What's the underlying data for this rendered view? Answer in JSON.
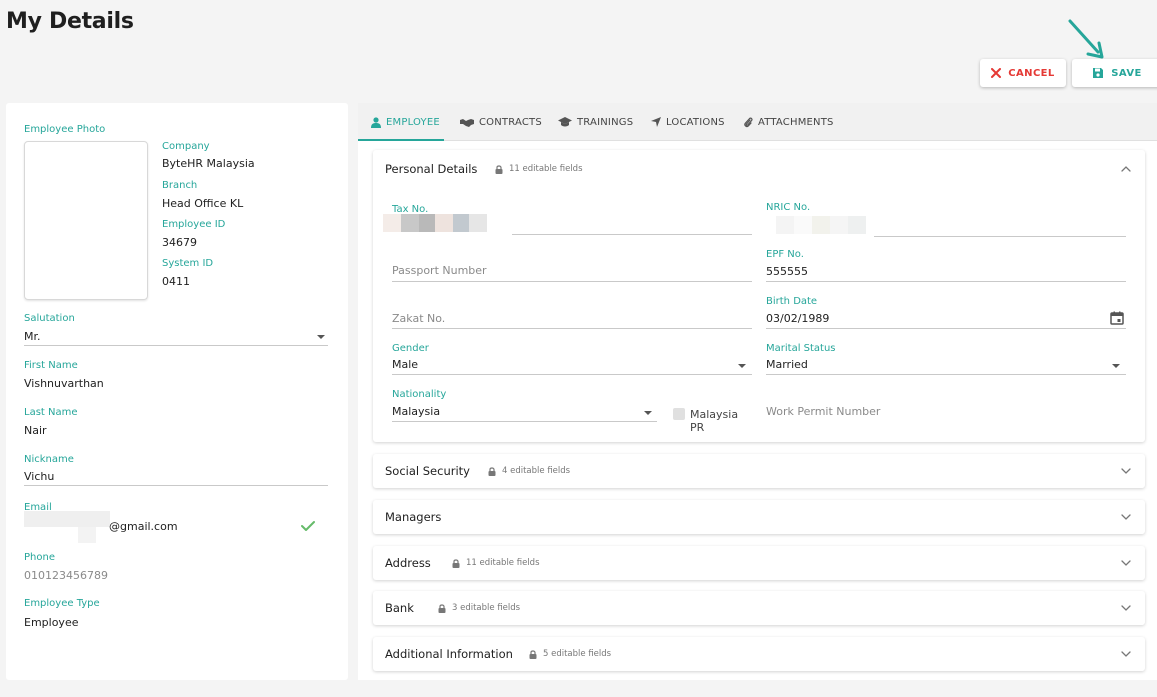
{
  "page": {
    "title": "My Details"
  },
  "toolbar": {
    "cancel_label": "CANCEL",
    "save_label": "SAVE"
  },
  "colors": {
    "accent": "#26a69a",
    "danger": "#e53935"
  },
  "left": {
    "photo_label": "Employee Photo",
    "company_label": "Company",
    "company": "ByteHR Malaysia",
    "branch_label": "Branch",
    "branch": "Head Office KL",
    "employee_id_label": "Employee ID",
    "employee_id": "34679",
    "system_id_label": "System ID",
    "system_id": "0411",
    "salutation_label": "Salutation",
    "salutation": "Mr.",
    "first_name_label": "First Name",
    "first_name": "Vishnuvarthan",
    "last_name_label": "Last Name",
    "last_name": "Nair",
    "nickname_label": "Nickname",
    "nickname": "Vichu",
    "email_label": "Email",
    "email_suffix": "@gmail.com",
    "phone_label": "Phone",
    "phone": "010123456789",
    "employee_type_label": "Employee Type",
    "employee_type": "Employee"
  },
  "tabs": [
    {
      "label": "EMPLOYEE",
      "icon": "person-icon"
    },
    {
      "label": "CONTRACTS",
      "icon": "handshake-icon"
    },
    {
      "label": "TRAININGS",
      "icon": "graduation-cap-icon"
    },
    {
      "label": "LOCATIONS",
      "icon": "location-arrow-icon"
    },
    {
      "label": "ATTACHMENTS",
      "icon": "paperclip-icon"
    }
  ],
  "personal": {
    "title": "Personal Details",
    "note": "11 editable fields",
    "tax_label": "Tax No.",
    "nric_label": "NRIC No.",
    "passport_placeholder": "Passport Number",
    "epf_label": "EPF No.",
    "epf": "555555",
    "zakat_placeholder": "Zakat No.",
    "birth_label": "Birth Date",
    "birth": "03/02/1989",
    "gender_label": "Gender",
    "gender": "Male",
    "marital_label": "Marital Status",
    "marital": "Married",
    "nationality_label": "Nationality",
    "nationality": "Malaysia",
    "pr_label": "Malaysia PR",
    "work_permit_placeholder": "Work Permit Number"
  },
  "sections": [
    {
      "title": "Social Security",
      "note": "4 editable fields"
    },
    {
      "title": "Managers",
      "note": ""
    },
    {
      "title": "Address",
      "note": "11 editable fields"
    },
    {
      "title": "Bank",
      "note": "3 editable fields"
    },
    {
      "title": "Additional Information",
      "note": "5 editable fields"
    }
  ]
}
